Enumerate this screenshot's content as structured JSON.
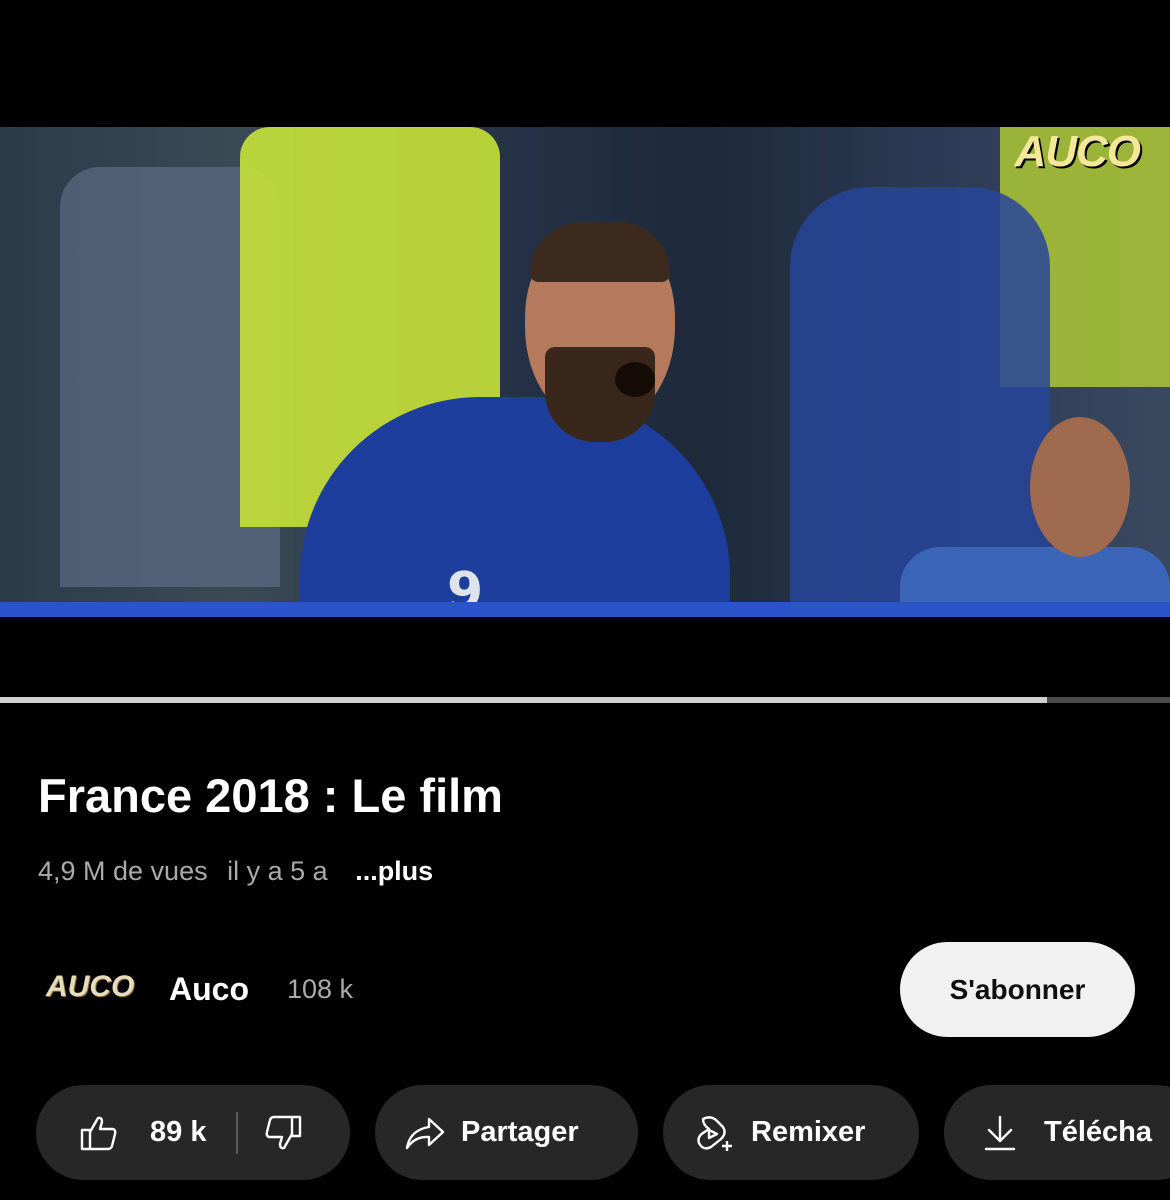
{
  "player": {
    "watermark": "AUCO",
    "jersey_number": "9",
    "progress_fraction": 0.895
  },
  "video": {
    "title": "France 2018 : Le film",
    "views": "4,9 M de vues",
    "age": "il y a 5 a",
    "more_label": "...plus"
  },
  "channel": {
    "logo_text": "AUCO",
    "name": "Auco",
    "subscribers": "108 k",
    "subscribe_label": "S'abonner"
  },
  "actions": {
    "like_count": "89 k",
    "share_label": "Partager",
    "remix_label": "Remixer",
    "download_label": "Télécha"
  },
  "icons": {
    "like": "thumbs-up-icon",
    "dislike": "thumbs-down-icon",
    "share": "share-arrow-icon",
    "remix": "remix-icon",
    "download": "download-icon"
  }
}
